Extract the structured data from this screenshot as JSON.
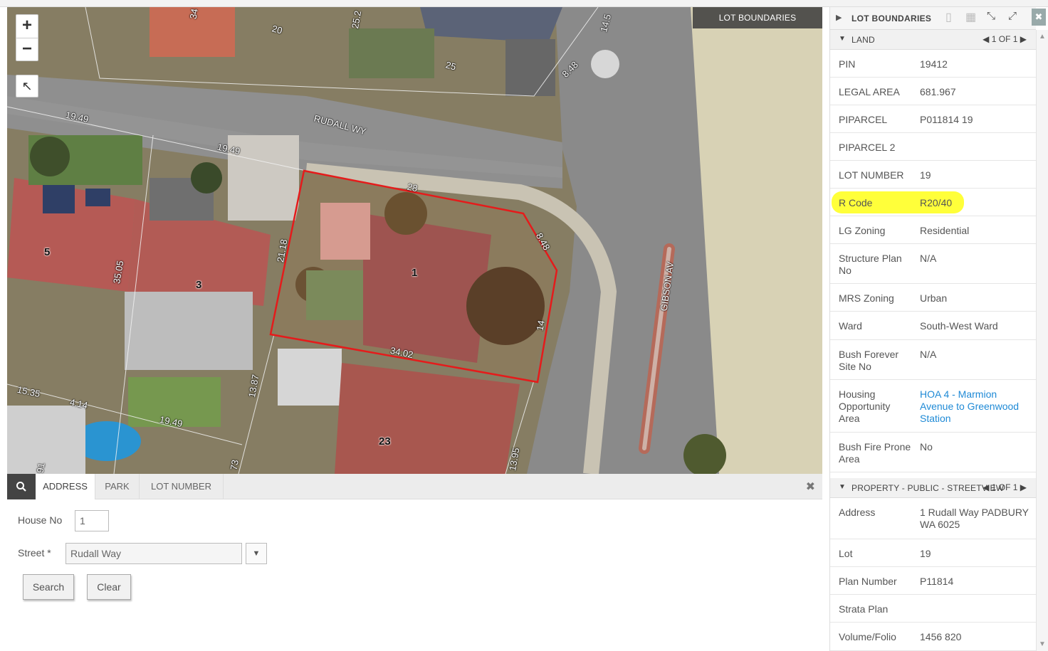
{
  "map": {
    "layer_label": "LOT BOUNDARIES",
    "zoom_in": "+",
    "zoom_out": "−",
    "street_labels": [
      "RUDALL WY",
      "GIBSON AV"
    ],
    "lot_numbers": [
      "1",
      "3",
      "5",
      "23"
    ],
    "dimensions": [
      "20",
      "25.2",
      "34",
      "25",
      "8.48",
      "14.5",
      "19.49",
      "19.49",
      "28",
      "8.48",
      "21.18",
      "14",
      "34.02",
      "35.05",
      "13.87",
      "15.35",
      "4.14",
      "19.49",
      "73",
      "13.95",
      "91"
    ]
  },
  "search": {
    "tabs": [
      "ADDRESS",
      "PARK",
      "LOT NUMBER"
    ],
    "house_no_label": "House No",
    "house_no_value": "1",
    "street_label": "Street *",
    "street_value": "Rudall Way",
    "search_button": "Search",
    "clear_button": "Clear"
  },
  "panel": {
    "title": "LOT BOUNDARIES",
    "land_section": {
      "title": "LAND",
      "pager": "1 OF 1",
      "rows": [
        {
          "k": "PIN",
          "v": "19412"
        },
        {
          "k": "LEGAL AREA",
          "v": "681.967"
        },
        {
          "k": "PIPARCEL",
          "v": "P011814 19"
        },
        {
          "k": "PIPARCEL 2",
          "v": ""
        },
        {
          "k": "LOT NUMBER",
          "v": "19"
        },
        {
          "k": "R Code",
          "v": "R20/40"
        },
        {
          "k": "LG Zoning",
          "v": "Residential"
        },
        {
          "k": "Structure Plan No",
          "v": "N/A"
        },
        {
          "k": "MRS Zoning",
          "v": "Urban"
        },
        {
          "k": "Ward",
          "v": "South-West Ward"
        },
        {
          "k": "Bush Forever Site No",
          "v": "N/A"
        },
        {
          "k": "Housing Opportunity Area",
          "v": "HOA 4 - Marmion Avenue to Greenwood Station"
        },
        {
          "k": "Bush Fire Prone Area",
          "v": "No"
        }
      ]
    },
    "property_section": {
      "title": "PROPERTY - PUBLIC - STREETVIEW",
      "pager": "1 OF 1",
      "rows": [
        {
          "k": "Address",
          "v": "1 Rudall Way PADBURY WA 6025"
        },
        {
          "k": "Lot",
          "v": "19"
        },
        {
          "k": "Plan Number",
          "v": "P11814"
        },
        {
          "k": "Strata Plan",
          "v": ""
        },
        {
          "k": "Volume/Folio",
          "v": "1456 820"
        }
      ]
    },
    "highlight_color": "#ffff3a",
    "link_color": "#1f8ad6"
  }
}
